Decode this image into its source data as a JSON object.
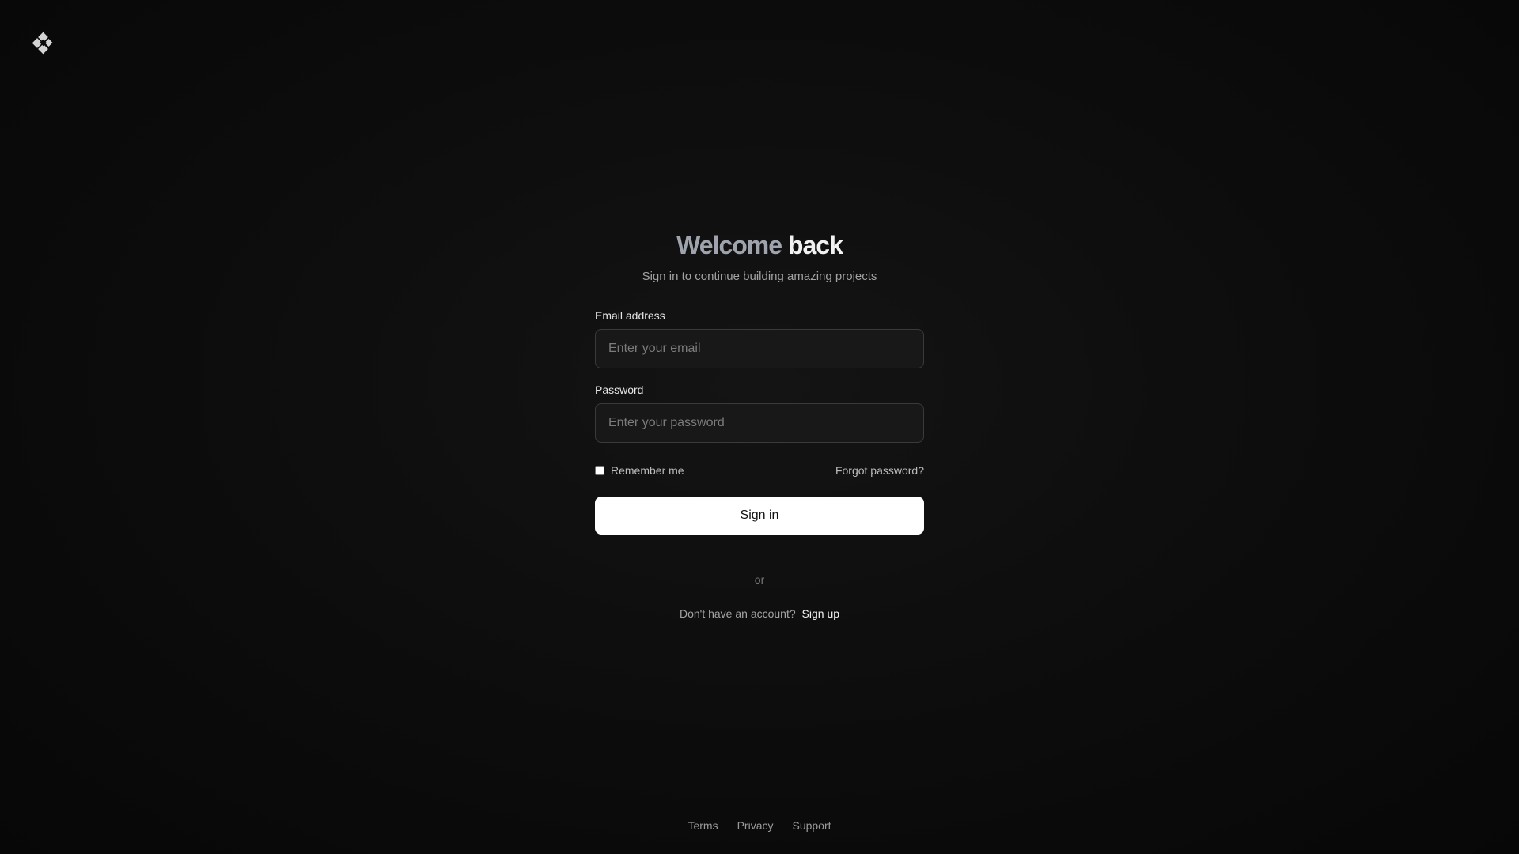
{
  "header": {
    "logo_icon": "diamond-logo-icon"
  },
  "auth": {
    "title_part1": "Welcome",
    "title_part2": "back",
    "subtitle": "Sign in to continue building amazing projects",
    "email_label": "Email address",
    "email_placeholder": "Enter your email",
    "email_value": "",
    "password_label": "Password",
    "password_placeholder": "Enter your password",
    "password_value": "",
    "remember_label": "Remember me",
    "remember_checked": false,
    "forgot_label": "Forgot password?",
    "signin_label": "Sign in",
    "divider_label": "or",
    "no_account_text": "Don't have an account?",
    "signup_label": "Sign up"
  },
  "footer": {
    "links": [
      "Terms",
      "Privacy",
      "Support"
    ]
  },
  "colors": {
    "background": "#0e0e0e",
    "primary_button": "#ffffff",
    "input_background": "#181818",
    "input_border": "#3a3a3a",
    "title_muted": "#9ea3ad"
  }
}
